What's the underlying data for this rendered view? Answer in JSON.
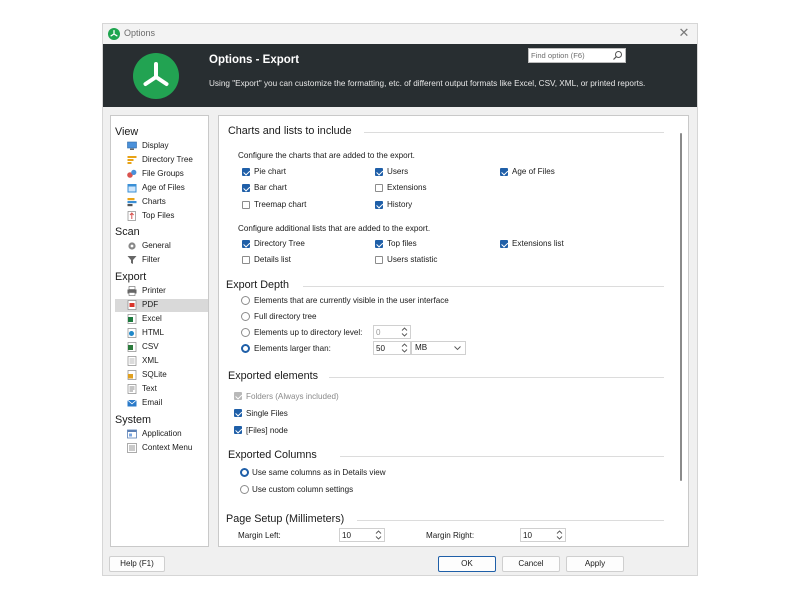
{
  "window": {
    "title": "Options"
  },
  "header": {
    "title": "Options - Export",
    "description": "Using \"Export\" you can customize the formatting, etc. of different output formats like Excel, CSV, XML, or printed reports.",
    "search_placeholder": "Find option (F6)"
  },
  "sidebar": {
    "sections": [
      {
        "label": "View",
        "items": [
          {
            "label": "Display",
            "icon": "monitor-icon"
          },
          {
            "label": "Directory Tree",
            "icon": "tree-icon"
          },
          {
            "label": "File Groups",
            "icon": "file-groups-icon"
          },
          {
            "label": "Age of Files",
            "icon": "calendar-icon"
          },
          {
            "label": "Charts",
            "icon": "chart-icon"
          },
          {
            "label": "Top Files",
            "icon": "top-files-icon"
          }
        ]
      },
      {
        "label": "Scan",
        "items": [
          {
            "label": "General",
            "icon": "gear-icon"
          },
          {
            "label": "Filter",
            "icon": "filter-icon"
          }
        ]
      },
      {
        "label": "Export",
        "items": [
          {
            "label": "Printer",
            "icon": "printer-icon"
          },
          {
            "label": "PDF",
            "icon": "pdf-icon"
          },
          {
            "label": "Excel",
            "icon": "excel-icon"
          },
          {
            "label": "HTML",
            "icon": "html-icon"
          },
          {
            "label": "CSV",
            "icon": "csv-icon"
          },
          {
            "label": "XML",
            "icon": "xml-icon"
          },
          {
            "label": "SQLite",
            "icon": "sqlite-icon"
          },
          {
            "label": "Text",
            "icon": "text-icon"
          },
          {
            "label": "Email",
            "icon": "email-icon"
          }
        ]
      },
      {
        "label": "System",
        "items": [
          {
            "label": "Application",
            "icon": "application-icon"
          },
          {
            "label": "Context Menu",
            "icon": "context-menu-icon"
          }
        ]
      }
    ],
    "selected": "PDF"
  },
  "charts_lists": {
    "heading": "Charts and lists to include",
    "charts_caption": "Configure the charts that are added to the export.",
    "charts": [
      {
        "label": "Pie chart",
        "checked": true
      },
      {
        "label": "Users",
        "checked": true
      },
      {
        "label": "Age of Files",
        "checked": true
      },
      {
        "label": "Bar chart",
        "checked": true
      },
      {
        "label": "Extensions",
        "checked": false
      },
      {
        "label": "Treemap chart",
        "checked": false
      },
      {
        "label": "History",
        "checked": true
      }
    ],
    "lists_caption": "Configure additional lists that are added to the export.",
    "lists": [
      {
        "label": "Directory Tree",
        "checked": true
      },
      {
        "label": "Top files",
        "checked": true
      },
      {
        "label": "Extensions list",
        "checked": true
      },
      {
        "label": "Details list",
        "checked": false
      },
      {
        "label": "Users statistic",
        "checked": false
      }
    ]
  },
  "export_depth": {
    "heading": "Export Depth",
    "options": [
      {
        "label": "Elements that are currently visible in the user interface",
        "selected": false
      },
      {
        "label": "Full directory tree",
        "selected": false
      },
      {
        "label": "Elements up to directory level:",
        "selected": false
      },
      {
        "label": "Elements larger than:",
        "selected": true
      }
    ],
    "directory_level": "0",
    "size_value": "50",
    "size_unit": "MB"
  },
  "exported_elements": {
    "heading": "Exported elements",
    "items": [
      {
        "label": "Folders (Always included)",
        "checked": true,
        "disabled": true
      },
      {
        "label": "Single Files",
        "checked": true,
        "disabled": false
      },
      {
        "label": "[Files] node",
        "checked": true,
        "disabled": false
      }
    ]
  },
  "exported_columns": {
    "heading": "Exported Columns",
    "options": [
      {
        "label": "Use same columns as in Details view",
        "selected": true
      },
      {
        "label": "Use custom column settings",
        "selected": false
      }
    ]
  },
  "page_setup": {
    "heading": "Page Setup (Millimeters)",
    "margin_left_label": "Margin Left:",
    "margin_left_value": "10",
    "margin_right_label": "Margin Right:",
    "margin_right_value": "10"
  },
  "buttons": {
    "help": "Help (F1)",
    "ok": "OK",
    "cancel": "Cancel",
    "apply": "Apply"
  },
  "colors": {
    "accent": "#1f5fa8",
    "brand_green": "#22a352",
    "header_bg": "#282e31"
  }
}
